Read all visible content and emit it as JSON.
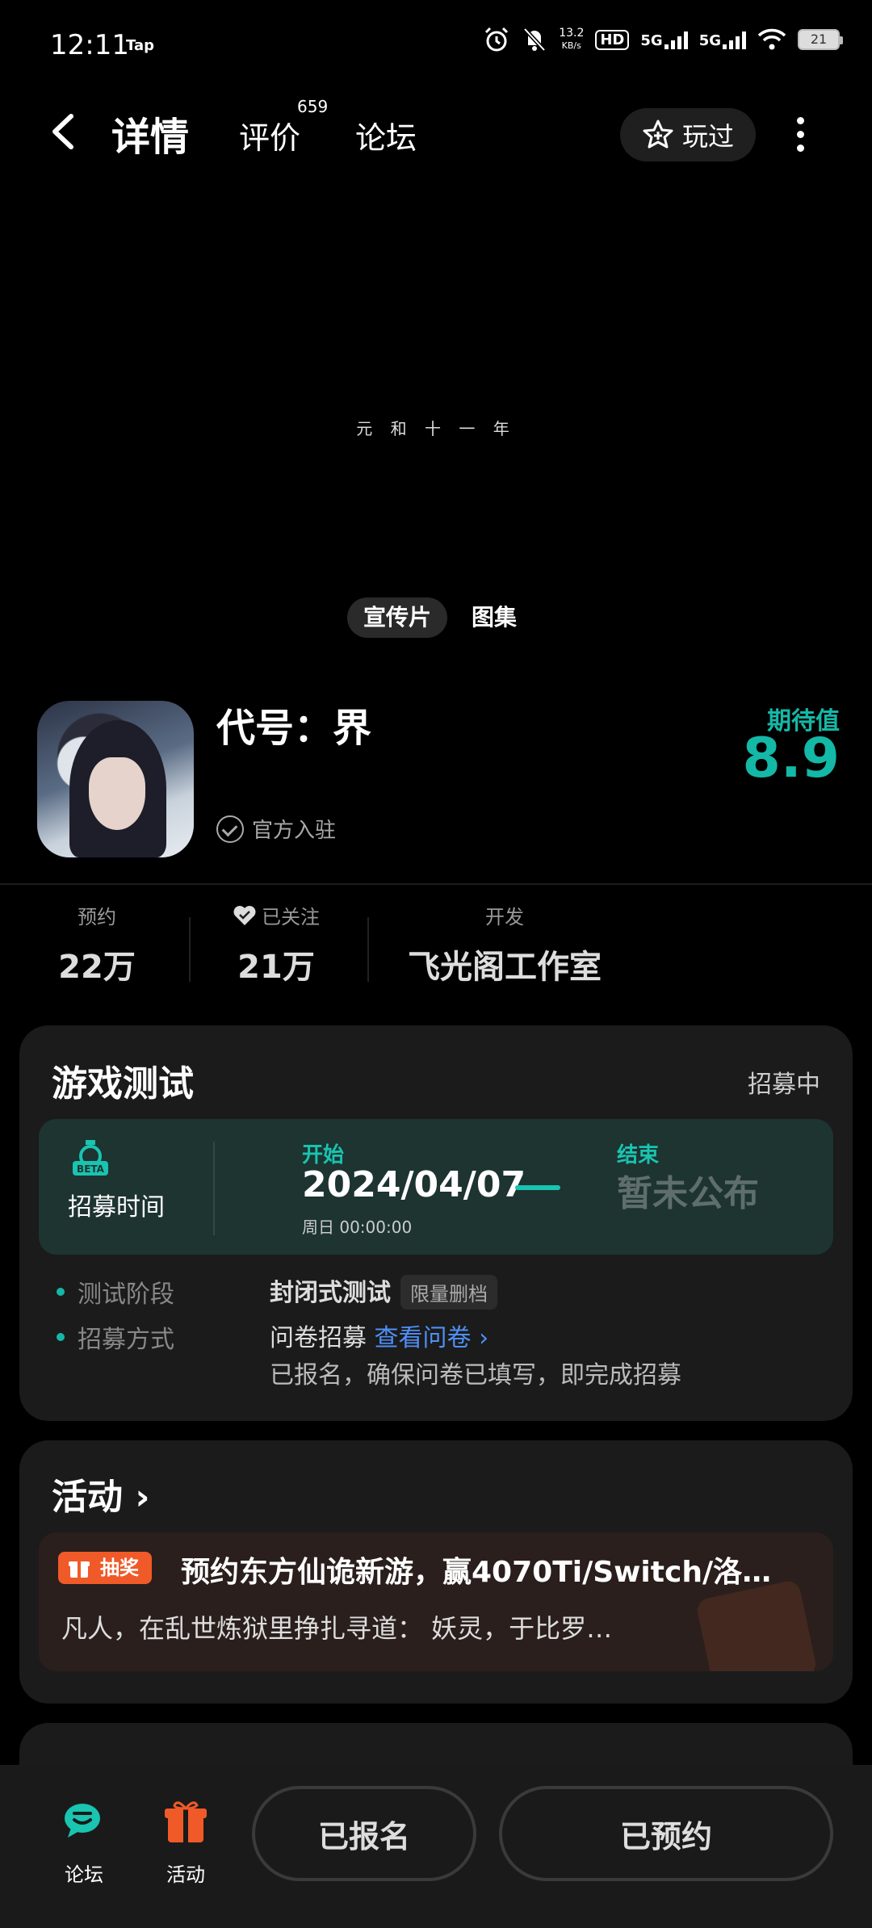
{
  "status_bar": {
    "time": "12:11",
    "app_badge": "Tap",
    "net_speed_value": "13.2",
    "net_speed_unit": "KB/s",
    "hd": "HD",
    "sig1": "5G",
    "sig2": "5G",
    "battery": "21"
  },
  "header": {
    "tab_detail": "详情",
    "tab_review": "评价",
    "review_count": "659",
    "tab_forum": "论坛",
    "played_label": "玩过"
  },
  "media": {
    "caption": "元 和 十 一 年",
    "tab_promo": "宣传片",
    "tab_gallery": "图集"
  },
  "game": {
    "name": "代号：界",
    "official_label": "官方入驻",
    "expect_label": "期待值",
    "expect_value": "8.9"
  },
  "stats": {
    "reserve_label": "预约",
    "reserve_value": "22万",
    "follow_label": "已关注",
    "follow_value": "21万",
    "dev_label": "开发",
    "dev_value": "飞光阁工作室"
  },
  "test_card": {
    "title": "游戏测试",
    "status": "招募中",
    "recruit_time_label": "招募时间",
    "start_label": "开始",
    "start_date": "2024/04/07",
    "start_time": "周日  00:00:00",
    "end_label": "结束",
    "end_value": "暂未公布",
    "stage_label": "测试阶段",
    "stage_value": "封闭式测试",
    "stage_tag": "限量删档",
    "method_label": "招募方式",
    "method_value": "问卷招募",
    "method_link": "查看问卷 ›",
    "method_note": "已报名，确保问卷已填写，即完成招募"
  },
  "activity_card": {
    "title": "活动 ›",
    "badge": "抽奖",
    "headline": "预约东方仙诡新游，赢4070Ti/Switch/洛…",
    "desc": "凡人，在乱世炼狱里挣扎寻道：  妖灵，于比罗…"
  },
  "bottom_bar": {
    "forum_label": "论坛",
    "activity_label": "活动",
    "signed_up": "已报名",
    "reserved": "已预约"
  }
}
